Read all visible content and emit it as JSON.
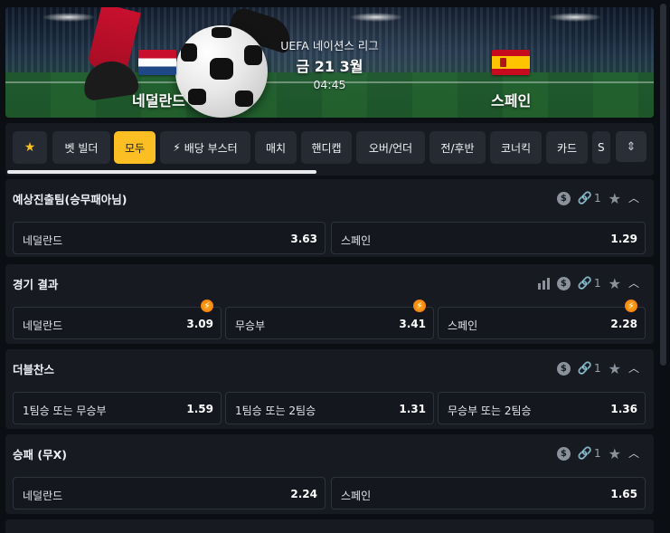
{
  "match": {
    "league": "UEFA 네이션스 리그",
    "date": "금 21 3월",
    "time": "04:45",
    "home": "네덜란드",
    "away": "스페인"
  },
  "filters": [
    {
      "label": "",
      "icon": "star-icon",
      "active": false
    },
    {
      "label": "벳 빌더",
      "active": false
    },
    {
      "label": "모두",
      "active": true
    },
    {
      "label": "배당 부스터",
      "icon": "bolt-icon",
      "active": false
    },
    {
      "label": "매치",
      "active": false
    },
    {
      "label": "핸디캡",
      "active": false
    },
    {
      "label": "오버/언더",
      "active": false
    },
    {
      "label": "전/후반",
      "active": false
    },
    {
      "label": "코너킥",
      "active": false
    },
    {
      "label": "카드",
      "active": false
    },
    {
      "label": "S",
      "active": false
    }
  ],
  "markets": [
    {
      "title": "예상진출팀(승무패아님)",
      "link_count": "1",
      "odds": [
        {
          "label": "네덜란드",
          "value": "3.63"
        },
        {
          "label": "스페인",
          "value": "1.29"
        }
      ]
    },
    {
      "title": "경기 결과",
      "link_count": "1",
      "odds": [
        {
          "label": "네덜란드",
          "value": "3.09",
          "boost": true
        },
        {
          "label": "무승부",
          "value": "3.41",
          "boost": true
        },
        {
          "label": "스페인",
          "value": "2.28",
          "boost": true
        }
      ]
    },
    {
      "title": "더블찬스",
      "link_count": "1",
      "odds": [
        {
          "label": "1팀승 또는 무승부",
          "value": "1.59"
        },
        {
          "label": "1팀승 또는 2팀승",
          "value": "1.31"
        },
        {
          "label": "무승부 또는 2팀승",
          "value": "1.36"
        }
      ]
    },
    {
      "title": "승패 (무X)",
      "link_count": "1",
      "odds": [
        {
          "label": "네덜란드",
          "value": "2.24"
        },
        {
          "label": "스페인",
          "value": "1.65"
        }
      ]
    }
  ],
  "colors": {
    "accent": "#fbbf24",
    "panel": "#171b21",
    "background": "#0b0f14"
  }
}
